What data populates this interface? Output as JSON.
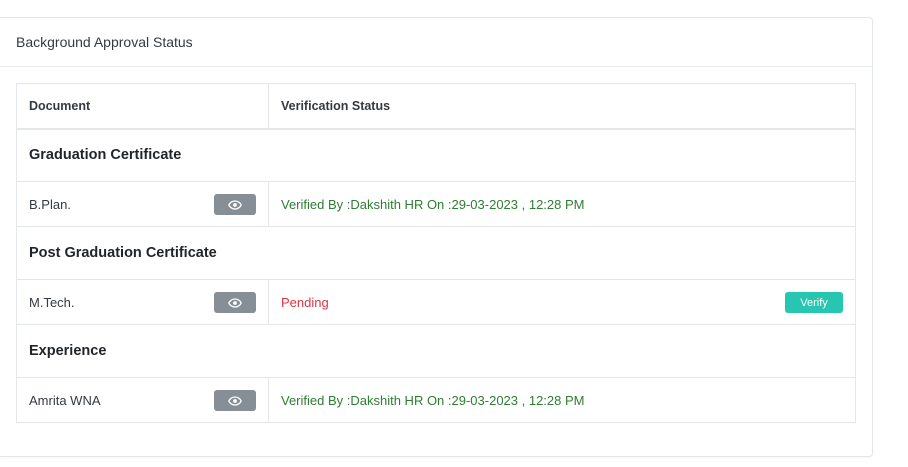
{
  "card": {
    "title": "Background Approval Status"
  },
  "table": {
    "headers": [
      "Document",
      "Verification Status"
    ],
    "groups": [
      {
        "title": "Graduation Certificate",
        "item": {
          "document": "B.Plan.",
          "status": "Verified By :Dakshith HR On :29-03-2023 , 12:28 PM",
          "status_type": "verified"
        }
      },
      {
        "title": "Post Graduation Certificate",
        "item": {
          "document": "M.Tech.",
          "status": "Pending",
          "status_type": "pending",
          "action_label": "Verify"
        }
      },
      {
        "title": "Experience",
        "item": {
          "document": "Amrita WNA",
          "status": "Verified By :Dakshith HR On :29-03-2023 , 12:28 PM",
          "status_type": "verified"
        }
      }
    ]
  },
  "icons": {
    "view": "eye-icon"
  },
  "colors": {
    "verified": "#2e7d32",
    "pending": "#dc3545",
    "verify_button": "#26c6b0",
    "view_button": "#868e96"
  }
}
